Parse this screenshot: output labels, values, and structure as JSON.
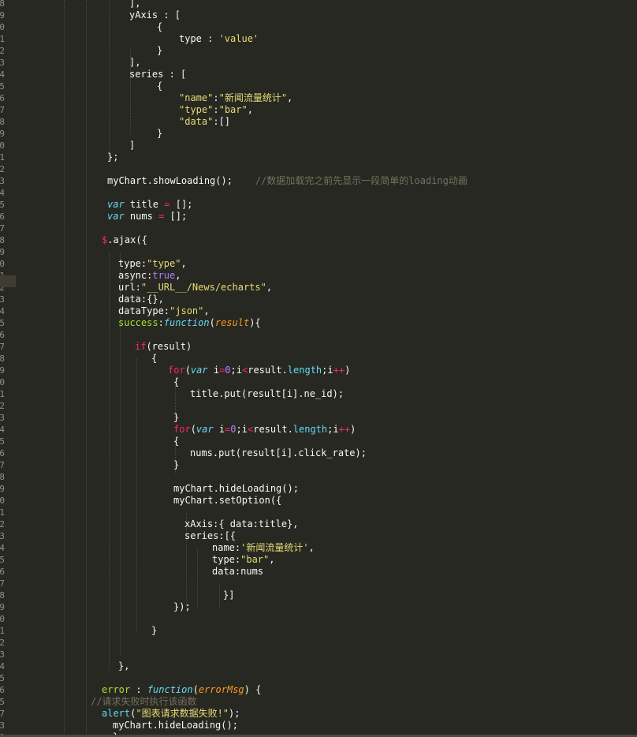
{
  "editor": {
    "cursor_line_index": 23,
    "lines": [
      {
        "ln": "8",
        "indent": 22,
        "tokens": [
          {
            "t": "],",
            "c": "p"
          }
        ]
      },
      {
        "ln": "9",
        "indent": 22,
        "tokens": [
          {
            "t": "yAxis : [",
            "c": "p"
          }
        ]
      },
      {
        "ln": "0",
        "indent": 27,
        "tokens": [
          {
            "t": "{",
            "c": "p"
          }
        ]
      },
      {
        "ln": "1",
        "indent": 31,
        "tokens": [
          {
            "t": "type : ",
            "c": "p"
          },
          {
            "t": "'value'",
            "c": "s"
          }
        ]
      },
      {
        "ln": "2",
        "indent": 27,
        "tokens": [
          {
            "t": "}",
            "c": "p"
          }
        ]
      },
      {
        "ln": "3",
        "indent": 22,
        "tokens": [
          {
            "t": "],",
            "c": "p"
          }
        ]
      },
      {
        "ln": "4",
        "indent": 22,
        "tokens": [
          {
            "t": "series : [",
            "c": "p"
          }
        ]
      },
      {
        "ln": "5",
        "indent": 27,
        "tokens": [
          {
            "t": "{",
            "c": "p"
          }
        ]
      },
      {
        "ln": "6",
        "indent": 31,
        "tokens": [
          {
            "t": "\"name\"",
            "c": "s"
          },
          {
            "t": ":",
            "c": "p"
          },
          {
            "t": "\"新闻流量统计\"",
            "c": "s"
          },
          {
            "t": ",",
            "c": "p"
          }
        ]
      },
      {
        "ln": "7",
        "indent": 31,
        "tokens": [
          {
            "t": "\"type\"",
            "c": "s"
          },
          {
            "t": ":",
            "c": "p"
          },
          {
            "t": "\"bar\"",
            "c": "s"
          },
          {
            "t": ",",
            "c": "p"
          }
        ]
      },
      {
        "ln": "8",
        "indent": 31,
        "tokens": [
          {
            "t": "\"data\"",
            "c": "s"
          },
          {
            "t": ":[]",
            "c": "p"
          }
        ]
      },
      {
        "ln": "9",
        "indent": 27,
        "tokens": [
          {
            "t": "}",
            "c": "p"
          }
        ]
      },
      {
        "ln": "0",
        "indent": 22,
        "tokens": [
          {
            "t": "]",
            "c": "p"
          }
        ]
      },
      {
        "ln": "1",
        "indent": 18,
        "tokens": [
          {
            "t": "};",
            "c": "p"
          }
        ]
      },
      {
        "ln": "2",
        "indent": 18,
        "tokens": []
      },
      {
        "ln": "3",
        "indent": 18,
        "tokens": [
          {
            "t": "myChart.showLoading();",
            "c": "p"
          },
          {
            "t": "    //数据加载完之前先显示一段简单的loading动画",
            "c": "c"
          }
        ]
      },
      {
        "ln": "4",
        "indent": 18,
        "tokens": []
      },
      {
        "ln": "5",
        "indent": 18,
        "tokens": [
          {
            "t": "var",
            "c": "st"
          },
          {
            "t": " title ",
            "c": "p"
          },
          {
            "t": "=",
            "c": "k"
          },
          {
            "t": " [];",
            "c": "p"
          }
        ]
      },
      {
        "ln": "6",
        "indent": 18,
        "tokens": [
          {
            "t": "var",
            "c": "st"
          },
          {
            "t": " nums ",
            "c": "p"
          },
          {
            "t": "=",
            "c": "k"
          },
          {
            "t": " [];",
            "c": "p"
          }
        ]
      },
      {
        "ln": "7",
        "indent": 18,
        "tokens": []
      },
      {
        "ln": "8",
        "indent": 17,
        "tokens": [
          {
            "t": "$",
            "c": "k"
          },
          {
            "t": ".ajax({",
            "c": "p"
          }
        ]
      },
      {
        "ln": "9",
        "indent": 17,
        "tokens": []
      },
      {
        "ln": "0",
        "indent": 20,
        "tokens": [
          {
            "t": "type:",
            "c": "p"
          },
          {
            "t": "\"type\"",
            "c": "s"
          },
          {
            "t": ",",
            "c": "p"
          }
        ]
      },
      {
        "ln": "1",
        "indent": 20,
        "tokens": [
          {
            "t": "async:",
            "c": "p"
          },
          {
            "t": "true",
            "c": "n"
          },
          {
            "t": ",",
            "c": "p"
          }
        ]
      },
      {
        "ln": "2",
        "indent": 20,
        "tokens": [
          {
            "t": "url:",
            "c": "p"
          },
          {
            "t": "\"__URL__/News/echarts\"",
            "c": "s"
          },
          {
            "t": ",",
            "c": "p"
          }
        ]
      },
      {
        "ln": "3",
        "indent": 20,
        "tokens": [
          {
            "t": "data:{},",
            "c": "p"
          }
        ]
      },
      {
        "ln": "4",
        "indent": 20,
        "tokens": [
          {
            "t": "dataType:",
            "c": "p"
          },
          {
            "t": "\"json\"",
            "c": "s"
          },
          {
            "t": ",",
            "c": "p"
          }
        ]
      },
      {
        "ln": "5",
        "indent": 20,
        "tokens": [
          {
            "t": "success",
            "c": "pr"
          },
          {
            "t": ":",
            "c": "p"
          },
          {
            "t": "function",
            "c": "f"
          },
          {
            "t": "(",
            "c": "p"
          },
          {
            "t": "result",
            "c": "a"
          },
          {
            "t": "){",
            "c": "p"
          }
        ]
      },
      {
        "ln": "6",
        "indent": 20,
        "tokens": []
      },
      {
        "ln": "7",
        "indent": 23,
        "tokens": [
          {
            "t": "if",
            "c": "k"
          },
          {
            "t": "(result)",
            "c": "p"
          }
        ]
      },
      {
        "ln": "8",
        "indent": 26,
        "tokens": [
          {
            "t": "{",
            "c": "p"
          }
        ]
      },
      {
        "ln": "9",
        "indent": 29,
        "tokens": [
          {
            "t": "for",
            "c": "k"
          },
          {
            "t": "(",
            "c": "p"
          },
          {
            "t": "var",
            "c": "st"
          },
          {
            "t": " i",
            "c": "p"
          },
          {
            "t": "=",
            "c": "k"
          },
          {
            "t": "0",
            "c": "n"
          },
          {
            "t": ";i",
            "c": "p"
          },
          {
            "t": "<",
            "c": "k"
          },
          {
            "t": "result.",
            "c": "p"
          },
          {
            "t": "length",
            "c": "bi"
          },
          {
            "t": ";i",
            "c": "p"
          },
          {
            "t": "++",
            "c": "k"
          },
          {
            "t": ")",
            "c": "p"
          }
        ]
      },
      {
        "ln": "0",
        "indent": 30,
        "tokens": [
          {
            "t": "{",
            "c": "p"
          }
        ]
      },
      {
        "ln": "1",
        "indent": 33,
        "tokens": [
          {
            "t": "title.put(result[i].ne_id);",
            "c": "p"
          }
        ]
      },
      {
        "ln": "2",
        "indent": 30,
        "tokens": []
      },
      {
        "ln": "3",
        "indent": 30,
        "tokens": [
          {
            "t": "}",
            "c": "p"
          }
        ]
      },
      {
        "ln": "4",
        "indent": 30,
        "tokens": [
          {
            "t": "for",
            "c": "k"
          },
          {
            "t": "(",
            "c": "p"
          },
          {
            "t": "var",
            "c": "st"
          },
          {
            "t": " i",
            "c": "p"
          },
          {
            "t": "=",
            "c": "k"
          },
          {
            "t": "0",
            "c": "n"
          },
          {
            "t": ";i",
            "c": "p"
          },
          {
            "t": "<",
            "c": "k"
          },
          {
            "t": "result.",
            "c": "p"
          },
          {
            "t": "length",
            "c": "bi"
          },
          {
            "t": ";i",
            "c": "p"
          },
          {
            "t": "++",
            "c": "k"
          },
          {
            "t": ")",
            "c": "p"
          }
        ]
      },
      {
        "ln": "5",
        "indent": 30,
        "tokens": [
          {
            "t": "{",
            "c": "p"
          }
        ]
      },
      {
        "ln": "6",
        "indent": 33,
        "tokens": [
          {
            "t": "nums.put(result[i].click_rate);",
            "c": "p"
          }
        ]
      },
      {
        "ln": "7",
        "indent": 30,
        "tokens": [
          {
            "t": "}",
            "c": "p"
          }
        ]
      },
      {
        "ln": "8",
        "indent": 30,
        "tokens": []
      },
      {
        "ln": "9",
        "indent": 30,
        "tokens": [
          {
            "t": "myChart.hideLoading();",
            "c": "p"
          }
        ]
      },
      {
        "ln": "0",
        "indent": 30,
        "tokens": [
          {
            "t": "myChart.setOption({",
            "c": "p"
          }
        ]
      },
      {
        "ln": "1",
        "indent": 30,
        "tokens": []
      },
      {
        "ln": "2",
        "indent": 32,
        "tokens": [
          {
            "t": "xAxis:{ data:title},",
            "c": "p"
          }
        ]
      },
      {
        "ln": "3",
        "indent": 32,
        "tokens": [
          {
            "t": "series:[{",
            "c": "p"
          }
        ]
      },
      {
        "ln": "4",
        "indent": 37,
        "tokens": [
          {
            "t": "name:",
            "c": "p"
          },
          {
            "t": "'新闻流量统计'",
            "c": "s"
          },
          {
            "t": ",",
            "c": "p"
          }
        ]
      },
      {
        "ln": "5",
        "indent": 37,
        "tokens": [
          {
            "t": "type:",
            "c": "p"
          },
          {
            "t": "\"bar\"",
            "c": "s"
          },
          {
            "t": ",",
            "c": "p"
          }
        ]
      },
      {
        "ln": "6",
        "indent": 37,
        "tokens": [
          {
            "t": "data:nums",
            "c": "p"
          }
        ]
      },
      {
        "ln": "7",
        "indent": 37,
        "tokens": []
      },
      {
        "ln": "8",
        "indent": 39,
        "tokens": [
          {
            "t": "}]",
            "c": "p"
          }
        ]
      },
      {
        "ln": "9",
        "indent": 30,
        "tokens": [
          {
            "t": "});",
            "c": "p"
          }
        ]
      },
      {
        "ln": "0",
        "indent": 30,
        "tokens": []
      },
      {
        "ln": "1",
        "indent": 26,
        "tokens": [
          {
            "t": "}",
            "c": "p"
          }
        ]
      },
      {
        "ln": "2",
        "indent": 26,
        "tokens": []
      },
      {
        "ln": "3",
        "indent": 20,
        "tokens": []
      },
      {
        "ln": "4",
        "indent": 20,
        "tokens": [
          {
            "t": "},",
            "c": "p"
          }
        ]
      },
      {
        "ln": "5",
        "indent": 17,
        "tokens": []
      },
      {
        "ln": "6",
        "indent": 17,
        "tokens": [
          {
            "t": "error",
            "c": "pr"
          },
          {
            "t": " : ",
            "c": "p"
          },
          {
            "t": "function",
            "c": "f"
          },
          {
            "t": "(",
            "c": "p"
          },
          {
            "t": "errorMsg",
            "c": "a"
          },
          {
            "t": ") {",
            "c": "p"
          }
        ]
      },
      {
        "ln": "5",
        "indent": 15,
        "tokens": [
          {
            "t": "//请求失败时执行该函数",
            "c": "c"
          }
        ]
      },
      {
        "ln": "7",
        "indent": 17,
        "tokens": [
          {
            "t": "alert",
            "c": "bi"
          },
          {
            "t": "(",
            "c": "p"
          },
          {
            "t": "\"图表请求数据失败!\"",
            "c": "s"
          },
          {
            "t": ");",
            "c": "p"
          }
        ]
      },
      {
        "ln": "3",
        "indent": 19,
        "tokens": [
          {
            "t": "myChart.hideLoading();",
            "c": "p"
          }
        ]
      },
      {
        "ln": "9",
        "indent": 19,
        "tokens": [
          {
            "t": "}",
            "c": "p"
          }
        ]
      }
    ]
  },
  "colors": {
    "background": "#272822",
    "plain": "#f8f8f2",
    "string": "#e6db74",
    "keyword": "#f92672",
    "storage": "#66d9ef",
    "comment": "#75715e",
    "number": "#ae81ff",
    "property": "#a6e22e",
    "argument": "#fd971f"
  }
}
